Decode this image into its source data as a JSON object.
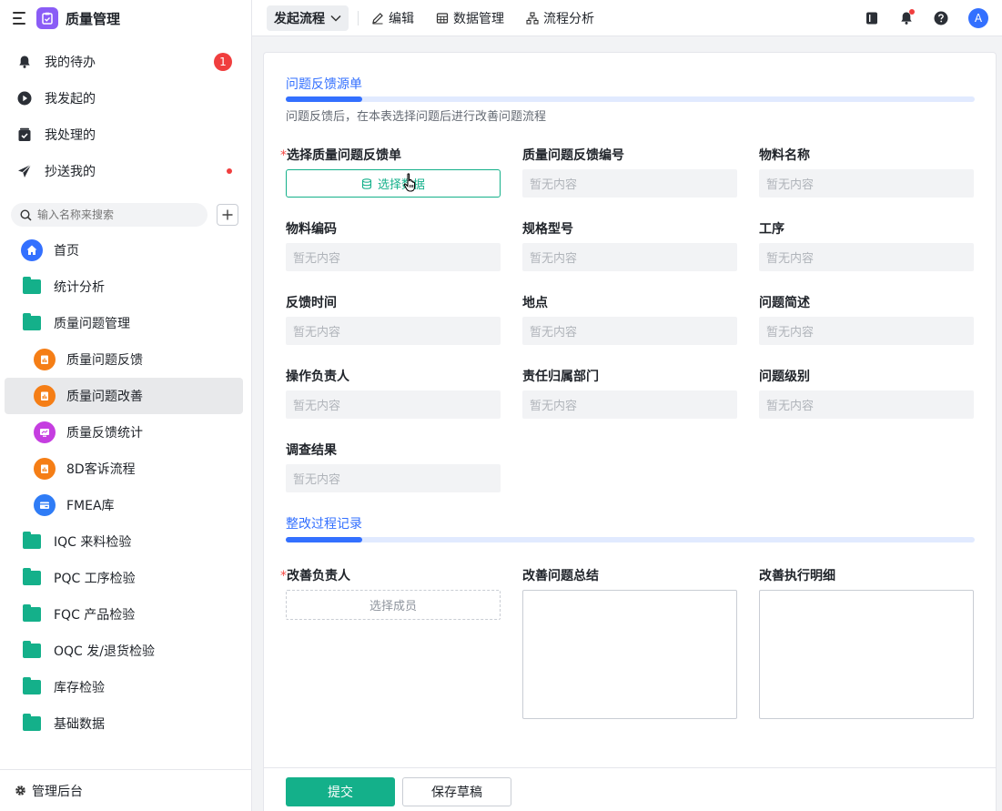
{
  "app": {
    "title": "质量管理"
  },
  "quick_nav": [
    {
      "label": "我的待办",
      "badge": "1"
    },
    {
      "label": "我发起的"
    },
    {
      "label": "我处理的"
    },
    {
      "label": "抄送我的",
      "dot": true
    }
  ],
  "search": {
    "placeholder": "输入名称来搜索"
  },
  "nav": [
    {
      "label": "首页",
      "icon": "home-icon"
    },
    {
      "label": "统计分析",
      "icon": "folder-icon"
    },
    {
      "label": "质量问题管理",
      "icon": "folder-open-icon"
    },
    {
      "label": "质量问题反馈",
      "icon": "form-icon",
      "sub": true
    },
    {
      "label": "质量问题改善",
      "icon": "form-icon",
      "sub": true,
      "active": true
    },
    {
      "label": "质量反馈统计",
      "icon": "dashboard-icon",
      "sub": true
    },
    {
      "label": "8D客诉流程",
      "icon": "form-icon",
      "sub": true
    },
    {
      "label": "FMEA库",
      "icon": "card-icon",
      "sub": true
    },
    {
      "label": "IQC 来料检验",
      "icon": "folder-icon"
    },
    {
      "label": "PQC 工序检验",
      "icon": "folder-icon"
    },
    {
      "label": "FQC 产品检验",
      "icon": "folder-icon"
    },
    {
      "label": "OQC 发/退货检验",
      "icon": "folder-icon"
    },
    {
      "label": "库存检验",
      "icon": "folder-icon"
    },
    {
      "label": "基础数据",
      "icon": "folder-icon"
    }
  ],
  "footer_nav": {
    "label": "管理后台"
  },
  "topbar": {
    "start_label": "发起流程",
    "edit_label": "编辑",
    "data_label": "数据管理",
    "analysis_label": "流程分析",
    "avatar": "A"
  },
  "form": {
    "section1": {
      "title": "问题反馈源单",
      "desc": "问题反馈后，在本表选择问题后进行改善问题流程"
    },
    "empty": "暂无内容",
    "select_data_label": "选择数据",
    "fields": [
      {
        "label": "选择质量问题反馈单",
        "required": true
      },
      {
        "label": "质量问题反馈编号"
      },
      {
        "label": "物料名称"
      },
      {
        "label": "物料编码"
      },
      {
        "label": "规格型号"
      },
      {
        "label": "工序"
      },
      {
        "label": "反馈时间"
      },
      {
        "label": "地点"
      },
      {
        "label": "问题简述"
      },
      {
        "label": "操作负责人"
      },
      {
        "label": "责任归属部门"
      },
      {
        "label": "问题级别"
      },
      {
        "label": "调查结果"
      }
    ],
    "section2": {
      "title": "整改过程记录"
    },
    "fields2": [
      {
        "label": "改善负责人",
        "required": true
      },
      {
        "label": "改善问题总结"
      },
      {
        "label": "改善执行明细"
      }
    ],
    "select_member_label": "选择成员",
    "submit_label": "提交",
    "draft_label": "保存草稿"
  },
  "colors": {
    "accent": "#3370ff",
    "primary": "#14b08a",
    "danger": "#f03e3e"
  }
}
